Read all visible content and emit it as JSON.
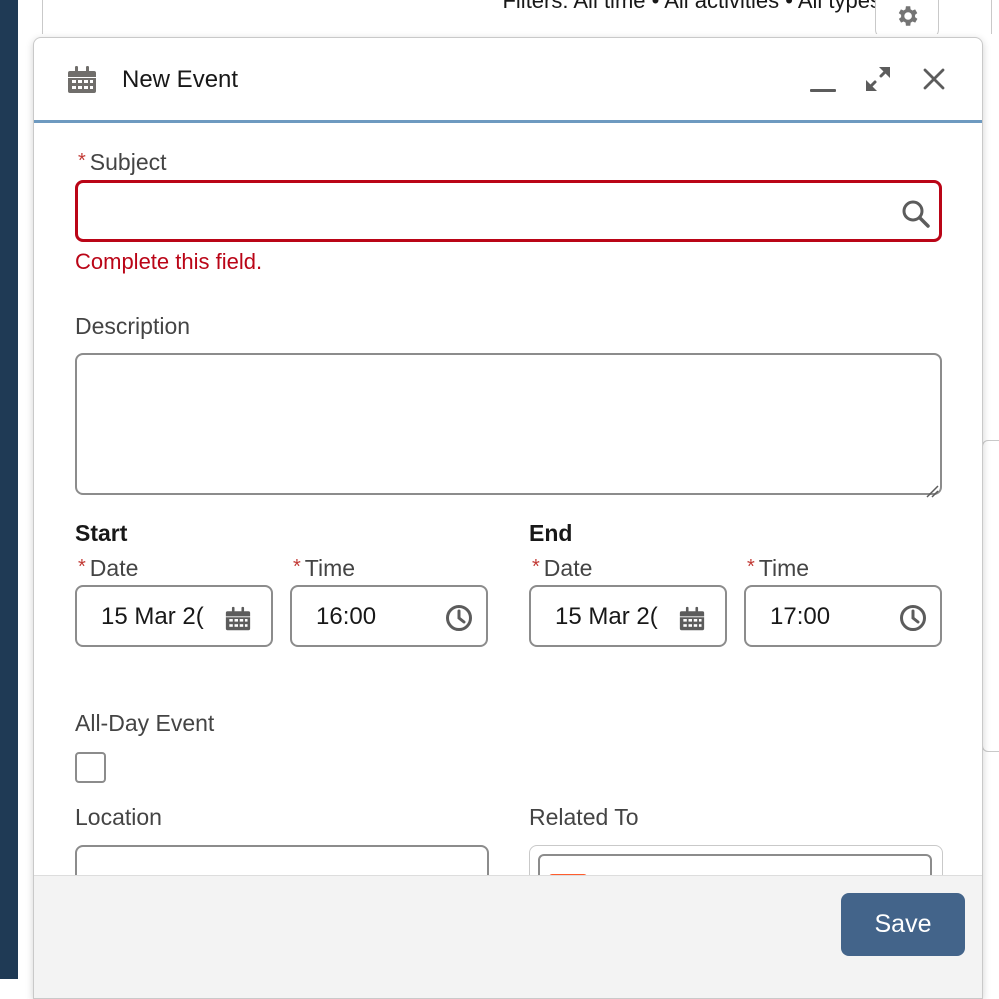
{
  "background": {
    "filters_text": "Filters: All time • All activities • All types",
    "icon": "gear-icon"
  },
  "modal": {
    "title": "New Event",
    "header_icon": "calendar-icon",
    "controls": [
      "minimize-icon",
      "expand-icon",
      "close-icon"
    ]
  },
  "form": {
    "subject": {
      "label": "Subject",
      "value": "",
      "error": "Complete this field.",
      "icon": "search-icon"
    },
    "description": {
      "label": "Description",
      "value": ""
    },
    "start": {
      "heading": "Start",
      "date_label": "Date",
      "date_value": "15 Mar 2(",
      "time_label": "Time",
      "time_value": "16:00"
    },
    "end": {
      "heading": "End",
      "date_label": "Date",
      "date_value": "15 Mar 2(",
      "time_label": "Time",
      "time_value": "17:00"
    },
    "all_day": {
      "label": "All-Day Event",
      "checked": false
    },
    "location": {
      "label": "Location",
      "value": ""
    },
    "related_to": {
      "label": "Related To"
    }
  },
  "footer": {
    "save_label": "Save"
  },
  "colors": {
    "error": "#ba0517",
    "accent_border": "#6e9ac0",
    "save_button": "#43648a",
    "required_star": "#c23934"
  }
}
